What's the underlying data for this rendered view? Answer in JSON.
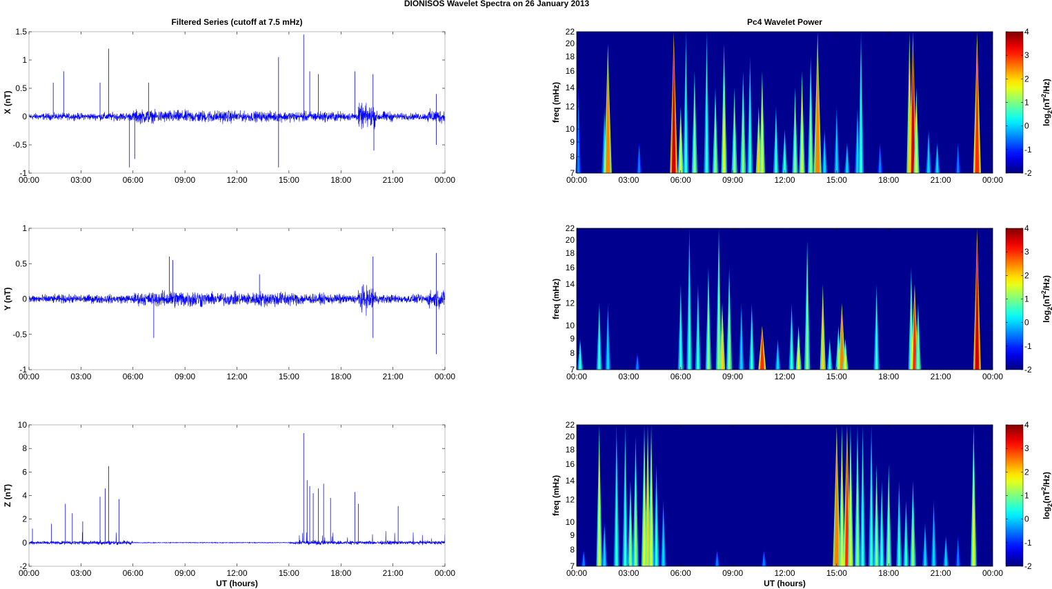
{
  "title": "DIONISOS Wavelet Spectra on 26 January   2013",
  "chart_data": [
    {
      "type": "line",
      "panel": "X",
      "title": "Filtered Series (cutoff at 7.5 mHz)",
      "ylabel": "X (nT)",
      "xlabel": "",
      "ylim": [
        -1,
        1.5
      ],
      "yticks": [
        "-1",
        "-0.5",
        "0",
        "0.5",
        "1",
        "1.5"
      ],
      "ytick_values": [
        -1,
        -0.5,
        0,
        0.5,
        1,
        1.5
      ],
      "xlim": [
        0,
        24
      ],
      "xticks": [
        "00:00",
        "03:00",
        "06:00",
        "09:00",
        "12:00",
        "15:00",
        "18:00",
        "21:00",
        "00:00"
      ],
      "noise_amplitude_by_hour": [
        0.1,
        0.1,
        0.1,
        0.1,
        0.12,
        0.12,
        0.2,
        0.18,
        0.18,
        0.18,
        0.18,
        0.18,
        0.15,
        0.15,
        0.15,
        0.15,
        0.15,
        0.15,
        0.12,
        0.35,
        0.15,
        0.1,
        0.1,
        0.2
      ],
      "spikes": [
        [
          1.4,
          0.6
        ],
        [
          2.0,
          0.8
        ],
        [
          4.1,
          0.6
        ],
        [
          4.6,
          1.2
        ],
        [
          5.8,
          -0.9
        ],
        [
          6.1,
          -0.75
        ],
        [
          6.9,
          0.6
        ],
        [
          14.4,
          1.05
        ],
        [
          14.4,
          -0.9
        ],
        [
          15.85,
          1.45
        ],
        [
          16.2,
          0.8
        ],
        [
          16.7,
          0.75
        ],
        [
          18.8,
          0.8
        ],
        [
          19.85,
          0.75
        ],
        [
          19.9,
          -0.6
        ],
        [
          23.5,
          0.4
        ],
        [
          23.5,
          -0.5
        ]
      ],
      "color": "#0000ff"
    },
    {
      "type": "line",
      "panel": "Y",
      "title": "",
      "ylabel": "Y (nT)",
      "xlabel": "",
      "ylim": [
        -1,
        1
      ],
      "yticks": [
        "-1",
        "-0.5",
        "0",
        "0.5",
        "1"
      ],
      "ytick_values": [
        -1,
        -0.5,
        0,
        0.5,
        1
      ],
      "xlim": [
        0,
        24
      ],
      "xticks": [
        "00:00",
        "03:00",
        "06:00",
        "09:00",
        "12:00",
        "15:00",
        "18:00",
        "21:00",
        "00:00"
      ],
      "noise_amplitude_by_hour": [
        0.1,
        0.1,
        0.1,
        0.1,
        0.1,
        0.1,
        0.15,
        0.18,
        0.2,
        0.2,
        0.15,
        0.15,
        0.15,
        0.18,
        0.18,
        0.15,
        0.12,
        0.12,
        0.1,
        0.3,
        0.1,
        0.1,
        0.1,
        0.2
      ],
      "spikes": [
        [
          7.2,
          -0.55
        ],
        [
          8.1,
          0.6
        ],
        [
          8.3,
          0.55
        ],
        [
          13.3,
          0.35
        ],
        [
          19.85,
          0.6
        ],
        [
          19.85,
          -0.55
        ],
        [
          23.5,
          0.65
        ],
        [
          23.5,
          -0.78
        ]
      ],
      "color": "#0000ff"
    },
    {
      "type": "line",
      "panel": "Z",
      "title": "",
      "ylabel": "Z (nT)",
      "xlabel": "UT (hours)",
      "ylim": [
        -2,
        10
      ],
      "yticks": [
        "-2",
        "0",
        "2",
        "4",
        "6",
        "8",
        "10"
      ],
      "ytick_values": [
        -2,
        0,
        2,
        4,
        6,
        8,
        10
      ],
      "xlim": [
        0,
        24
      ],
      "xticks": [
        "00:00",
        "03:00",
        "06:00",
        "09:00",
        "12:00",
        "15:00",
        "18:00",
        "21:00",
        "00:00"
      ],
      "noise_amplitude_by_hour": [
        0.25,
        0.25,
        0.25,
        0.25,
        0.3,
        0.3,
        0.05,
        0.05,
        0.05,
        0.05,
        0.05,
        0.05,
        0.05,
        0.05,
        0.05,
        0.2,
        0.3,
        0.3,
        0.3,
        0.25,
        0.25,
        0.25,
        0.25,
        0.25
      ],
      "spikes": [
        [
          0.2,
          1.2
        ],
        [
          1.3,
          1.6
        ],
        [
          2.1,
          3.3
        ],
        [
          2.5,
          2.5
        ],
        [
          3.1,
          1.8
        ],
        [
          4.1,
          3.9
        ],
        [
          4.4,
          4.6
        ],
        [
          4.6,
          6.5
        ],
        [
          5.2,
          3.7
        ],
        [
          15.85,
          9.3
        ],
        [
          16.05,
          5.3
        ],
        [
          16.2,
          4.8
        ],
        [
          16.4,
          4.2
        ],
        [
          16.7,
          4.6
        ],
        [
          17.0,
          5.0
        ],
        [
          17.4,
          3.8
        ],
        [
          18.8,
          4.3
        ],
        [
          19.0,
          3.3
        ],
        [
          21.3,
          3.1
        ]
      ],
      "color": "#0000ff"
    },
    {
      "type": "heatmap",
      "panel": "X",
      "title": "Pc4 Wavelet Power",
      "ylabel": "freq (mHz)",
      "xlabel": "",
      "ylim": [
        7,
        22
      ],
      "yscale": "log",
      "yticks": [
        "7",
        "8",
        "9",
        "10",
        "12",
        "14",
        "16",
        "18",
        "20",
        "22"
      ],
      "ytick_values": [
        7,
        8,
        9,
        10,
        12,
        14,
        16,
        18,
        20,
        22
      ],
      "xlim": [
        0,
        24
      ],
      "xticks": [
        "00:00",
        "03:00",
        "06:00",
        "09:00",
        "12:00",
        "15:00",
        "18:00",
        "21:00",
        "00:00"
      ],
      "colorbar": {
        "label": "log2(nT2/Hz)",
        "range": [
          -2,
          4
        ],
        "ticks": [
          "-2",
          "-1",
          "0",
          "1",
          "2",
          "3",
          "4"
        ]
      },
      "events_time_fmax_power": [
        [
          0.1,
          14,
          -0.5
        ],
        [
          1.6,
          12,
          0
        ],
        [
          1.8,
          20,
          2.5
        ],
        [
          3.6,
          9,
          -0.5
        ],
        [
          5.6,
          22,
          3.5
        ],
        [
          6.0,
          12,
          1.5
        ],
        [
          6.3,
          22,
          0.5
        ],
        [
          6.8,
          16,
          1
        ],
        [
          7.5,
          22,
          0.5
        ],
        [
          8.0,
          14,
          1
        ],
        [
          8.5,
          20,
          1.5
        ],
        [
          9.1,
          14,
          1
        ],
        [
          9.6,
          16,
          1
        ],
        [
          10.0,
          18,
          0.5
        ],
        [
          10.5,
          12,
          2
        ],
        [
          10.7,
          16,
          1.5
        ],
        [
          11.5,
          12,
          0.5
        ],
        [
          12.0,
          10,
          0.5
        ],
        [
          12.6,
          14,
          1
        ],
        [
          13.0,
          16,
          1.5
        ],
        [
          13.5,
          18,
          1
        ],
        [
          13.9,
          22,
          2.5
        ],
        [
          14.3,
          10,
          0
        ],
        [
          15.0,
          12,
          0
        ],
        [
          15.6,
          9,
          0
        ],
        [
          16.2,
          12,
          0
        ],
        [
          16.4,
          22,
          0.5
        ],
        [
          17.5,
          9,
          -0.5
        ],
        [
          19.2,
          22,
          2
        ],
        [
          19.4,
          22,
          3.5
        ],
        [
          19.6,
          14,
          1.5
        ],
        [
          20.3,
          10,
          0
        ],
        [
          20.8,
          9,
          0
        ],
        [
          22.0,
          9,
          -0.5
        ],
        [
          23.1,
          22,
          3
        ]
      ]
    },
    {
      "type": "heatmap",
      "panel": "Y",
      "title": "",
      "ylabel": "freq (mHz)",
      "xlabel": "",
      "ylim": [
        7,
        22
      ],
      "yscale": "log",
      "yticks": [
        "7",
        "8",
        "9",
        "10",
        "12",
        "14",
        "16",
        "18",
        "20",
        "22"
      ],
      "ytick_values": [
        7,
        8,
        9,
        10,
        12,
        14,
        16,
        18,
        20,
        22
      ],
      "xlim": [
        0,
        24
      ],
      "xticks": [
        "00:00",
        "03:00",
        "06:00",
        "09:00",
        "12:00",
        "15:00",
        "18:00",
        "21:00",
        "00:00"
      ],
      "colorbar": {
        "label": "log2(nT2/Hz)",
        "range": [
          -2,
          4
        ],
        "ticks": [
          "-2",
          "-1",
          "0",
          "1",
          "2",
          "3",
          "4"
        ]
      },
      "events_time_fmax_power": [
        [
          0.2,
          9,
          0.5
        ],
        [
          1.3,
          12,
          0.5
        ],
        [
          1.8,
          12,
          0
        ],
        [
          3.5,
          8,
          -0.5
        ],
        [
          6.0,
          14,
          0.5
        ],
        [
          6.5,
          22,
          0.5
        ],
        [
          7.0,
          14,
          0.5
        ],
        [
          7.6,
          16,
          1
        ],
        [
          8.2,
          22,
          1
        ],
        [
          8.4,
          12,
          2
        ],
        [
          8.8,
          16,
          1
        ],
        [
          9.5,
          12,
          0
        ],
        [
          10.1,
          12,
          0.5
        ],
        [
          10.7,
          10,
          3
        ],
        [
          11.6,
          9,
          0
        ],
        [
          12.4,
          12,
          0.5
        ],
        [
          12.8,
          10,
          1.5
        ],
        [
          13.3,
          20,
          1
        ],
        [
          14.2,
          14,
          2
        ],
        [
          14.6,
          9,
          0.5
        ],
        [
          15.1,
          10,
          1
        ],
        [
          15.3,
          12,
          2.5
        ],
        [
          15.5,
          9,
          1.5
        ],
        [
          17.3,
          14,
          0.5
        ],
        [
          19.3,
          16,
          1
        ],
        [
          19.5,
          14,
          3
        ],
        [
          19.7,
          12,
          1
        ],
        [
          23.1,
          22,
          3.5
        ]
      ]
    },
    {
      "type": "heatmap",
      "panel": "Z",
      "title": "",
      "ylabel": "freq (mHz)",
      "xlabel": "UT (hours)",
      "ylim": [
        7,
        22
      ],
      "yscale": "log",
      "yticks": [
        "7",
        "8",
        "9",
        "10",
        "12",
        "14",
        "16",
        "18",
        "20",
        "22"
      ],
      "ytick_values": [
        7,
        8,
        9,
        10,
        12,
        14,
        16,
        18,
        20,
        22
      ],
      "xlim": [
        0,
        24
      ],
      "xticks": [
        "00:00",
        "03:00",
        "06:00",
        "09:00",
        "12:00",
        "15:00",
        "18:00",
        "21:00",
        "00:00"
      ],
      "colorbar": {
        "label": "log2(nT2/Hz)",
        "range": [
          -2,
          4
        ],
        "ticks": [
          "-2",
          "-1",
          "0",
          "1",
          "2",
          "3",
          "4"
        ]
      },
      "events_time_fmax_power": [
        [
          0.4,
          8,
          -0.5
        ],
        [
          1.3,
          22,
          1.5
        ],
        [
          1.6,
          10,
          0
        ],
        [
          2.3,
          22,
          0.5
        ],
        [
          2.8,
          22,
          0.5
        ],
        [
          3.1,
          14,
          1
        ],
        [
          3.4,
          20,
          1
        ],
        [
          3.9,
          22,
          1.5
        ],
        [
          4.1,
          22,
          2
        ],
        [
          4.3,
          22,
          1.5
        ],
        [
          4.6,
          16,
          0.5
        ],
        [
          5.0,
          12,
          0
        ],
        [
          8.1,
          8,
          -0.5
        ],
        [
          10.8,
          8,
          -0.5
        ],
        [
          15.0,
          22,
          2.5
        ],
        [
          15.3,
          22,
          1.5
        ],
        [
          15.6,
          22,
          3
        ],
        [
          15.8,
          22,
          1.5
        ],
        [
          16.2,
          22,
          1
        ],
        [
          16.5,
          22,
          0.5
        ],
        [
          17.0,
          22,
          0.5
        ],
        [
          17.3,
          16,
          1
        ],
        [
          17.6,
          14,
          0.5
        ],
        [
          18.0,
          16,
          1
        ],
        [
          18.6,
          14,
          0.5
        ],
        [
          19.0,
          12,
          0.5
        ],
        [
          19.4,
          14,
          1
        ],
        [
          20.1,
          10,
          0
        ],
        [
          20.6,
          12,
          0
        ],
        [
          21.3,
          9,
          0
        ],
        [
          22.0,
          9,
          -0.5
        ],
        [
          22.9,
          22,
          1.5
        ]
      ]
    }
  ]
}
